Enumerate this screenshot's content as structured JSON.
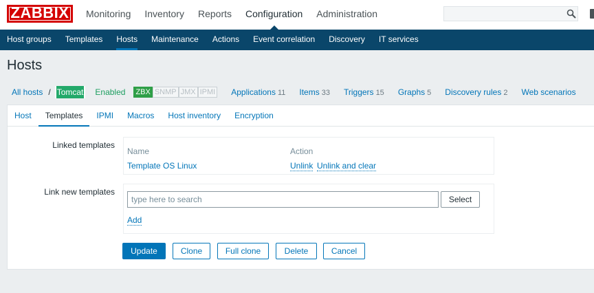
{
  "app": {
    "logo": "ZABBIX"
  },
  "top_menu": {
    "items": [
      {
        "label": "Monitoring"
      },
      {
        "label": "Inventory"
      },
      {
        "label": "Reports"
      },
      {
        "label": "Configuration",
        "active": true
      },
      {
        "label": "Administration"
      }
    ],
    "search_placeholder": ""
  },
  "sub_menu": {
    "items": [
      {
        "label": "Host groups"
      },
      {
        "label": "Templates"
      },
      {
        "label": "Hosts",
        "active": true
      },
      {
        "label": "Maintenance"
      },
      {
        "label": "Actions"
      },
      {
        "label": "Event correlation"
      },
      {
        "label": "Discovery"
      },
      {
        "label": "IT services"
      }
    ]
  },
  "page": {
    "title": "Hosts"
  },
  "breadcrumb": {
    "all_hosts": "All hosts",
    "separator": "/",
    "current_host": "Tomcat",
    "status": "Enabled",
    "availability": [
      {
        "label": "ZBX",
        "active": true
      },
      {
        "label": "SNMP",
        "active": false
      },
      {
        "label": "JMX",
        "active": false
      },
      {
        "label": "IPMI",
        "active": false
      }
    ],
    "entities": [
      {
        "label": "Applications",
        "count": "11"
      },
      {
        "label": "Items",
        "count": "33"
      },
      {
        "label": "Triggers",
        "count": "15"
      },
      {
        "label": "Graphs",
        "count": "5"
      },
      {
        "label": "Discovery rules",
        "count": "2"
      },
      {
        "label": "Web scenarios",
        "count": ""
      }
    ]
  },
  "tabs": [
    {
      "label": "Host"
    },
    {
      "label": "Templates",
      "active": true
    },
    {
      "label": "IPMI"
    },
    {
      "label": "Macros"
    },
    {
      "label": "Host inventory"
    },
    {
      "label": "Encryption"
    }
  ],
  "form": {
    "linked_templates_label": "Linked templates",
    "linked_table": {
      "col_name": "Name",
      "col_action": "Action",
      "rows": [
        {
          "name": "Template OS Linux",
          "unlink": "Unlink",
          "unlink_clear": "Unlink and clear"
        }
      ]
    },
    "link_new_label": "Link new templates",
    "search_placeholder": "type here to search",
    "search_value": "",
    "select_button": "Select",
    "add_link": "Add"
  },
  "buttons": {
    "update": "Update",
    "clone": "Clone",
    "full_clone": "Full clone",
    "delete": "Delete",
    "cancel": "Cancel"
  },
  "colors": {
    "header_blue": "#0a466a",
    "link_blue": "#0275b8",
    "logo_red": "#d40000",
    "enabled_green": "#1d9e60"
  }
}
